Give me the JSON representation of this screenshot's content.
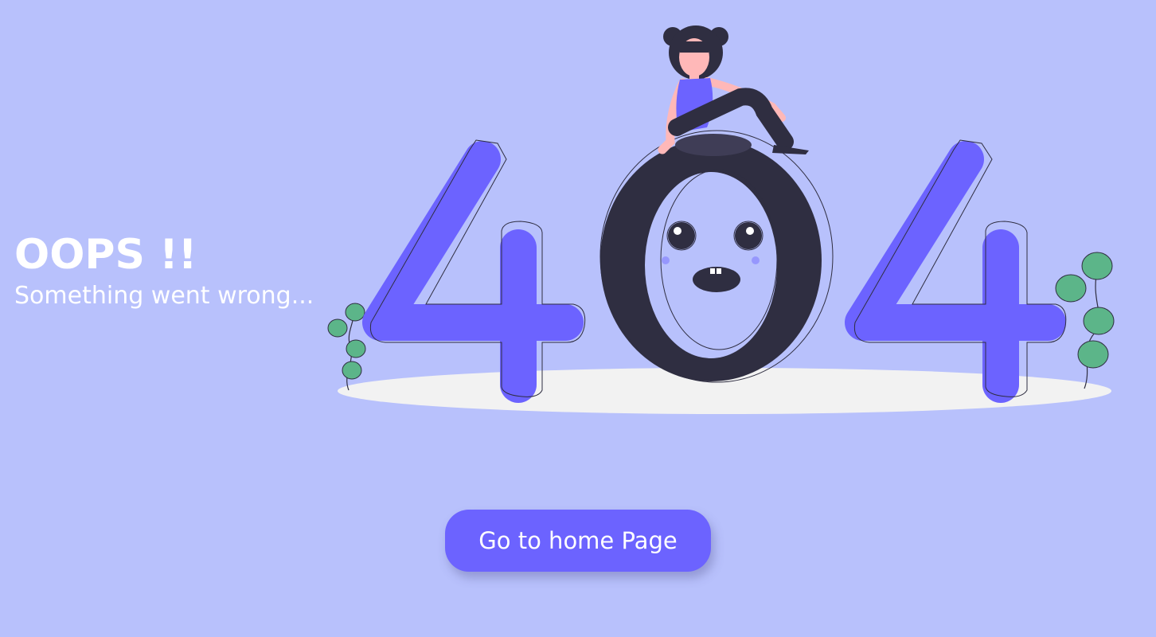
{
  "error": {
    "heading": "OOPS !!",
    "subheading": "Something went wrong...",
    "code_digits": [
      "4",
      "0",
      "4"
    ]
  },
  "actions": {
    "home_label": "Go to home Page"
  },
  "colors": {
    "background": "#b8c1fc",
    "accent": "#6c63ff",
    "dark": "#2f2e41",
    "leaf": "#5cb589",
    "skin": "#ffb8b8",
    "shadow_ellipse": "#f2f2f2"
  },
  "icons": [
    "error-404-illustration",
    "sitting-person-icon",
    "plant-leaves-icon"
  ]
}
